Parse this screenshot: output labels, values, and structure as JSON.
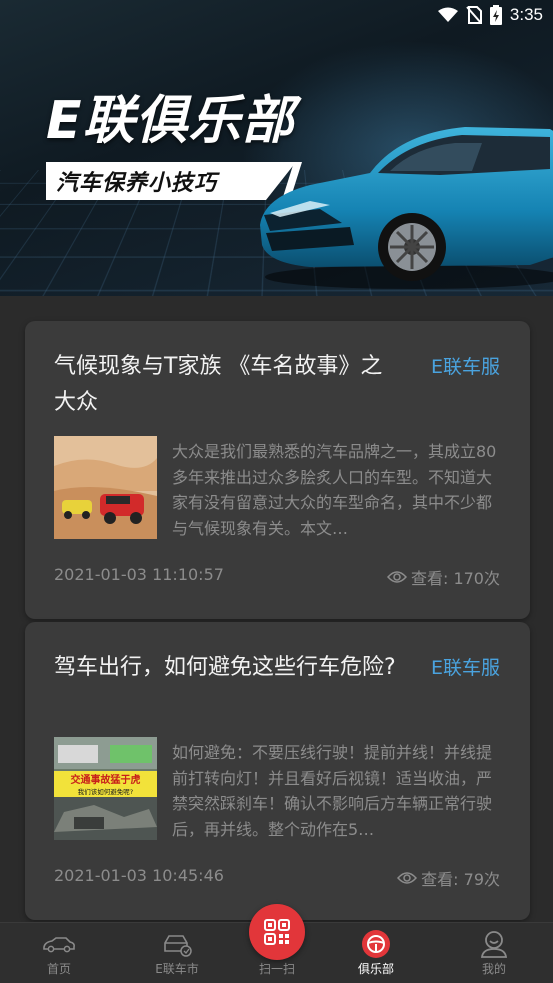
{
  "status_bar": {
    "time": "3:35"
  },
  "banner": {
    "title": "E联俱乐部",
    "subtitle": "汽车保养小技巧"
  },
  "articles": [
    {
      "title": "气候现象与T家族 《车名故事》之大众",
      "source": "E联车服",
      "summary": "大众是我们最熟悉的汽车品牌之一，其成立80多年来推出过众多脍炙人口的车型。不知道大家有没有留意过大众的车型命名，其中不少都与气候现象有关。本文…",
      "date": "2021-01-03 11:10:57",
      "views": "查看: 170次"
    },
    {
      "title": "驾车出行，如何避免这些行车危险?",
      "source": "E联车服",
      "summary": "如何避免：不要压线行驶！提前并线！并线提前打转向灯！并且看好后视镜！适当收油，严禁突然踩刹车！确认不影响后方车辆正常行驶后，再并线。整个动作在5…",
      "thumb_caption": "交通事故猛于虎",
      "thumb_subcaption": "我们该如何避免呢?",
      "date": "2021-01-03 10:45:46",
      "views": "查看: 79次"
    }
  ],
  "nav": {
    "home": "首页",
    "market": "E联车市",
    "scan": "扫一扫",
    "club": "俱乐部",
    "mine": "我的"
  },
  "colors": {
    "accent": "#4aa3df",
    "scan": "#e2363a",
    "card": "#3b3b3b",
    "background": "#2b2b2b"
  }
}
